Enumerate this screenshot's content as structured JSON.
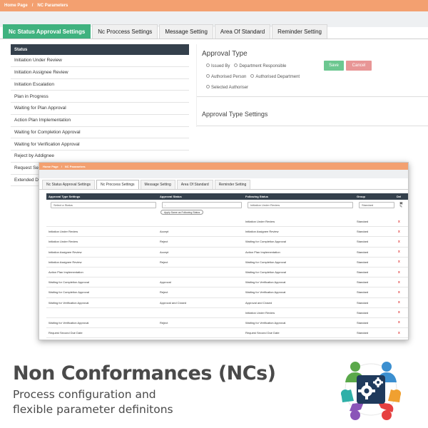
{
  "breadcrumb": {
    "home": "Home Page",
    "separator": "/",
    "current": "NC Parameters"
  },
  "tabs": [
    {
      "label": "Nc Status Approval Settings",
      "active": true
    },
    {
      "label": "Nc Proccess Settings",
      "active": false
    },
    {
      "label": "Message Setting",
      "active": false
    },
    {
      "label": "Area Of Standard",
      "active": false
    },
    {
      "label": "Reminder Setting",
      "active": false
    }
  ],
  "status_list": {
    "header": "Status",
    "items": [
      "Initiation Under Review",
      "Initiation Assignee Review",
      "Initiation Escalation",
      "Plan in Progress",
      "Waiting for Plan Approval",
      "Action Plan Implementation",
      "Waiting for Completion Approval",
      "Waiting for Verification Approval",
      "Reject by Addignee",
      "Request Se",
      "Extended D"
    ]
  },
  "approval_type": {
    "title": "Approval Type",
    "options": [
      "Issued By",
      "Department Responsible",
      "Authorised Person",
      "Authorised Department",
      "Selected Authoriser"
    ],
    "save_label": "Save",
    "cancel_label": "Cancel",
    "settings_title": "Approval Type Settings"
  },
  "process": {
    "breadcrumb": {
      "home": "Home Page",
      "separator": "/",
      "current": "NC Parameters"
    },
    "tabs": [
      {
        "label": "Nc Status Approval Settings",
        "active": false
      },
      {
        "label": "Nc Proccess Settings",
        "active": true
      },
      {
        "label": "Message Setting",
        "active": false
      },
      {
        "label": "Area Of Standard",
        "active": false
      },
      {
        "label": "Reminder Setting",
        "active": false
      }
    ],
    "columns": [
      "Approval Type Settings",
      "Approval Status",
      "Following Status",
      "Group",
      "Del"
    ],
    "filter": {
      "status_placeholder": "Select a Status",
      "approval_value": "-",
      "following_value": "Initiation Under Review",
      "group_value": "Standard",
      "apply_label": "Apply Same as Following Status"
    },
    "rows": [
      [
        "",
        "",
        "Initiation Under Review",
        "Standard"
      ],
      [
        "Initiation Under Review",
        "Accept",
        "Initiation Assignee Review",
        "Standard"
      ],
      [
        "Initiation Under Review",
        "Reject",
        "Waiting for Completion Approval",
        "Standard"
      ],
      [
        "Initiation Assignee Review",
        "Accept",
        "Action Plan Implementation",
        "Standard"
      ],
      [
        "Initiation Assignee Review",
        "Reject",
        "Waiting for Completion Approval",
        "Standard"
      ],
      [
        "Action Plan Implementation",
        "",
        "Waiting for Completion Approval",
        "Standard"
      ],
      [
        "Waiting for Completion Approval",
        "Approval",
        "Waiting for Verification Approval",
        "Standard"
      ],
      [
        "Waiting for Completion Approval",
        "Reject",
        "Waiting for Verification Approval",
        "Standard"
      ],
      [
        "Waiting for Verification Approval",
        "Approval and Closed",
        "Approval and Closed",
        "Standard"
      ],
      [
        "",
        "",
        "Initiation Under Review",
        "Standard"
      ],
      [
        "Waiting for Verification Approval",
        "Reject",
        "Waiting for Verification Approval",
        "Standard"
      ],
      [
        "Request Second Due Date",
        "",
        "Request Second Due Date",
        "Standard"
      ]
    ],
    "delete_icon": "x",
    "save_icon": "save-icon",
    "edit_icon": "edit-icon"
  },
  "hero": {
    "title": "Non Conformances (NCs)",
    "subtitle_line1": "Process configuration and",
    "subtitle_line2": "flexible parameter definitons"
  },
  "colors": {
    "accent_orange": "#f3a070",
    "tab_active_green": "#3fb27f",
    "header_dark": "#34404c",
    "save_green": "#6cc790",
    "cancel_red": "#e89696",
    "delete_red": "#e04040"
  }
}
